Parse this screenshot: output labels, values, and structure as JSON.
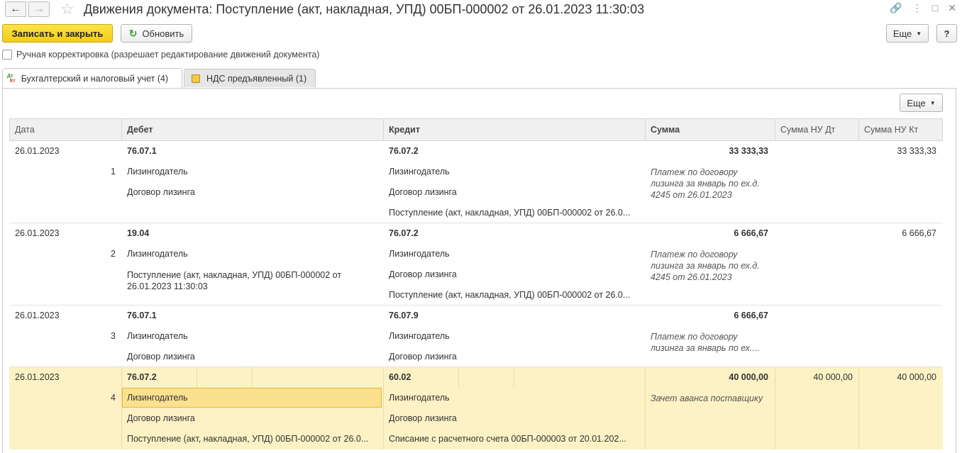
{
  "window": {
    "title": "Движения документа: Поступление (акт, накладная, УПД) 00БП-000002 от 26.01.2023 11:30:03",
    "back_icon": "arrow-left-icon",
    "forward_icon": "arrow-right-icon",
    "favorite_icon": "star-icon",
    "link_icon": "link-icon",
    "menu_icon": "more-vertical-icon",
    "maximize_icon": "maximize-icon",
    "close_icon": "close-icon"
  },
  "toolbar": {
    "save_close_label": "Записать и закрыть",
    "refresh_label": "Обновить",
    "more_label": "Еще",
    "help_label": "?"
  },
  "manual_correction": {
    "label": "Ручная корректировка (разрешает редактирование движений документа)",
    "checked": false
  },
  "tabs": [
    {
      "label": "Бухгалтерский и налоговый учет (4)",
      "icon": "dt-kt-icon",
      "active": true
    },
    {
      "label": "НДС предъявленный (1)",
      "icon": "vat-register-icon",
      "active": false
    }
  ],
  "panel": {
    "more_label": "Еще"
  },
  "table": {
    "columns": [
      "Дата",
      "Дебет",
      "Кредит",
      "Сумма",
      "Сумма НУ Дт",
      "Сумма НУ Кт"
    ],
    "rows": [
      {
        "date": "26.01.2023",
        "num": "1",
        "debit_account": "76.07.1",
        "debit_lines": [
          "Лизингодатель",
          "Договор лизинга"
        ],
        "credit_account": "76.07.2",
        "credit_lines": [
          "Лизингодатель",
          "Договор лизинга",
          "Поступление (акт, накладная, УПД) 00БП-000002 от 26.0..."
        ],
        "amount": "33 333,33",
        "comment": "Платеж по договору лизинга за январь по ех.д. 4245 от 26.01.2023",
        "amount_nu_dt": "",
        "amount_nu_kt": "33 333,33"
      },
      {
        "date": "26.01.2023",
        "num": "2",
        "debit_account": "19.04",
        "debit_lines": [
          "Лизингодатель",
          "Поступление (акт, накладная, УПД) 00БП-000002 от 26.01.2023 11:30:03"
        ],
        "credit_account": "76.07.2",
        "credit_lines": [
          "Лизингодатель",
          "Договор лизинга",
          "Поступление (акт, накладная, УПД) 00БП-000002 от 26.0..."
        ],
        "amount": "6 666,67",
        "comment": "Платеж по договору лизинга за январь по ех.д. 4245 от 26.01.2023",
        "amount_nu_dt": "",
        "amount_nu_kt": "6 666,67"
      },
      {
        "date": "26.01.2023",
        "num": "3",
        "debit_account": "76.07.1",
        "debit_lines": [
          "Лизингодатель",
          "Договор лизинга"
        ],
        "credit_account": "76.07.9",
        "credit_lines": [
          "Лизингодатель",
          "Договор лизинга"
        ],
        "amount": "6 666,67",
        "comment": "Платеж по договору лизинга за январь по ех....",
        "amount_nu_dt": "",
        "amount_nu_kt": ""
      },
      {
        "date": "26.01.2023",
        "num": "4",
        "debit_account": "76.07.2",
        "debit_lines": [
          "Лизингодатель",
          "Договор лизинга",
          "Поступление (акт, накладная, УПД) 00БП-000002 от 26.0..."
        ],
        "credit_account": "60.02",
        "credit_lines": [
          "Лизингодатель",
          "Договор лизинга",
          "Списание с расчетного счета 00БП-000003 от 20.01.202..."
        ],
        "amount": "40 000,00",
        "comment": "Зачет аванса поставщику",
        "amount_nu_dt": "40 000,00",
        "amount_nu_kt": "40 000,00"
      }
    ]
  }
}
